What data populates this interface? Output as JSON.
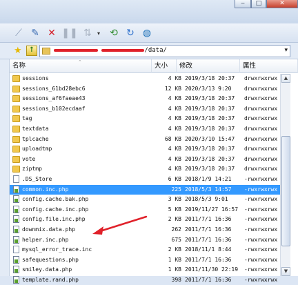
{
  "window": {
    "controls": {
      "minimize": "‒",
      "maximize": "□",
      "close": "✕"
    }
  },
  "toolbar": {
    "icons": [
      "connect-icon",
      "edit-icon",
      "delete-icon",
      "pause-icon",
      "transfer-icon",
      "dropdown-icon",
      "sync-icon",
      "refresh-icon",
      "globe-icon"
    ]
  },
  "address": {
    "path_suffix": "/data/",
    "redacted": true
  },
  "columns": {
    "name": "名称",
    "size": "大小",
    "modified": "修改",
    "attributes": "属性"
  },
  "files": [
    {
      "name": "sessions",
      "type": "folder",
      "size": "4 KB",
      "modified": "2019/3/18 20:37",
      "attr": "drwxrwxrwx"
    },
    {
      "name": "sessions_61bd28ebc6",
      "type": "folder",
      "size": "12 KB",
      "modified": "2020/3/13 9:20",
      "attr": "drwxrwxrwx"
    },
    {
      "name": "sessions_af6faeae43",
      "type": "folder",
      "size": "4 KB",
      "modified": "2019/3/18 20:37",
      "attr": "drwxrwxrwx"
    },
    {
      "name": "sessions_b102ecdaaf",
      "type": "folder",
      "size": "4 KB",
      "modified": "2019/3/18 20:37",
      "attr": "drwxrwxrwx"
    },
    {
      "name": "tag",
      "type": "folder",
      "size": "4 KB",
      "modified": "2019/3/18 20:37",
      "attr": "drwxrwxrwx"
    },
    {
      "name": "textdata",
      "type": "folder",
      "size": "4 KB",
      "modified": "2019/3/18 20:37",
      "attr": "drwxrwxrwx"
    },
    {
      "name": "tplcache",
      "type": "folder",
      "size": "68 KB",
      "modified": "2020/3/10 15:47",
      "attr": "drwxrwxrwx"
    },
    {
      "name": "uploadtmp",
      "type": "folder",
      "size": "4 KB",
      "modified": "2019/3/18 20:37",
      "attr": "drwxrwxrwx"
    },
    {
      "name": "vote",
      "type": "folder",
      "size": "4 KB",
      "modified": "2019/3/18 20:37",
      "attr": "drwxrwxrwx"
    },
    {
      "name": "ziptmp",
      "type": "folder",
      "size": "4 KB",
      "modified": "2019/3/18 20:37",
      "attr": "drwxrwxrwx"
    },
    {
      "name": ".DS_Store",
      "type": "file",
      "size": "6 KB",
      "modified": "2018/1/9 14:21",
      "attr": "-rwxrwxrwx"
    },
    {
      "name": "common.inc.php",
      "type": "php",
      "size": "225",
      "modified": "2018/5/3 14:57",
      "attr": "-rwxrwxrwx",
      "selected": true
    },
    {
      "name": "config.cache.bak.php",
      "type": "php",
      "size": "3 KB",
      "modified": "2018/5/3 9:01",
      "attr": "-rwxrwxrwx"
    },
    {
      "name": "config.cache.inc.php",
      "type": "php",
      "size": "5 KB",
      "modified": "2019/11/27 16:57",
      "attr": "-rwxrwxrwx"
    },
    {
      "name": "config.file.inc.php",
      "type": "php",
      "size": "2 KB",
      "modified": "2011/7/1 16:36",
      "attr": "-rwxrwxrwx"
    },
    {
      "name": "downmix.data.php",
      "type": "php",
      "size": "262",
      "modified": "2011/7/1 16:36",
      "attr": "-rwxrwxrwx"
    },
    {
      "name": "helper.inc.php",
      "type": "php",
      "size": "675",
      "modified": "2011/7/1 16:36",
      "attr": "-rwxrwxrwx"
    },
    {
      "name": "mysql_error_trace.inc",
      "type": "file",
      "size": "2 KB",
      "modified": "2018/11/1 8:44",
      "attr": "-rwxrwxrwx"
    },
    {
      "name": "safequestions.php",
      "type": "php",
      "size": "1 KB",
      "modified": "2011/7/1 16:36",
      "attr": "-rwxrwxrwx"
    },
    {
      "name": "smiley.data.php",
      "type": "php",
      "size": "1 KB",
      "modified": "2011/11/30 22:19",
      "attr": "-rwxrwxrwx"
    },
    {
      "name": "template.rand.php",
      "type": "php",
      "size": "398",
      "modified": "2011/7/1 16:36",
      "attr": "-rwxrwxrwx"
    }
  ],
  "colors": {
    "selection": "#3399ff",
    "annotation_arrow": "#e0212a"
  }
}
